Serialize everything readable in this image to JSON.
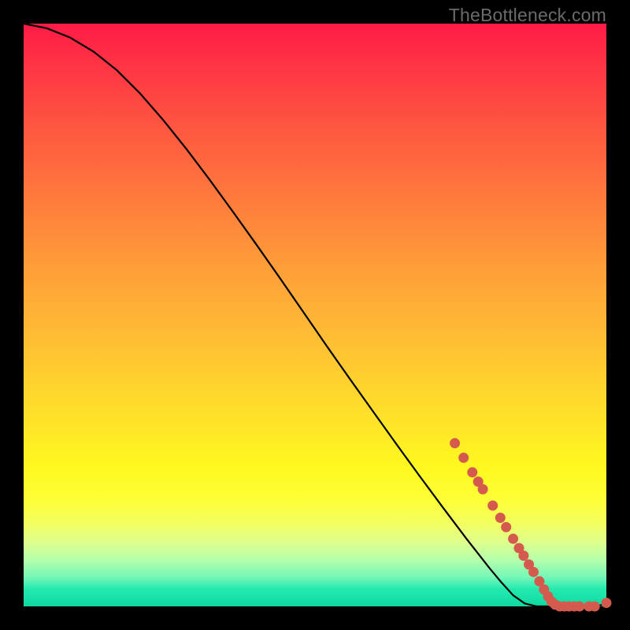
{
  "watermark": "TheBottleneck.com",
  "colors": {
    "curve": "#000000",
    "marker_fill": "#d35a4d",
    "marker_stroke": "#a8433a"
  },
  "chart_data": {
    "type": "line",
    "title": "",
    "xlabel": "",
    "ylabel": "",
    "xlim": [
      0,
      100
    ],
    "ylim": [
      0,
      100
    ],
    "grid": false,
    "series": [
      {
        "name": "curve",
        "x": [
          0,
          4,
          8,
          12,
          16,
          20,
          24,
          28,
          32,
          36,
          40,
          44,
          48,
          52,
          56,
          60,
          64,
          68,
          72,
          76,
          80,
          82,
          84,
          86,
          88,
          90,
          92,
          94,
          96,
          98,
          100
        ],
        "y": [
          100,
          99.2,
          97.6,
          95.2,
          92.0,
          88.0,
          83.4,
          78.4,
          73.1,
          67.6,
          62.0,
          56.3,
          50.5,
          44.7,
          39.0,
          33.4,
          27.8,
          22.3,
          16.9,
          11.6,
          6.5,
          4.1,
          1.9,
          0.5,
          0.0,
          0.0,
          0.0,
          0.0,
          0.0,
          0.0,
          0.4
        ]
      }
    ],
    "markers": [
      {
        "x": 74.0,
        "y": 28.0
      },
      {
        "x": 75.5,
        "y": 25.5
      },
      {
        "x": 77.0,
        "y": 23.0
      },
      {
        "x": 78.0,
        "y": 21.4
      },
      {
        "x": 78.8,
        "y": 20.1
      },
      {
        "x": 80.5,
        "y": 17.3
      },
      {
        "x": 81.8,
        "y": 15.2
      },
      {
        "x": 82.8,
        "y": 13.6
      },
      {
        "x": 84.0,
        "y": 11.6
      },
      {
        "x": 85.0,
        "y": 10.0
      },
      {
        "x": 85.8,
        "y": 8.7
      },
      {
        "x": 86.7,
        "y": 7.2
      },
      {
        "x": 87.5,
        "y": 5.9
      },
      {
        "x": 88.5,
        "y": 4.3
      },
      {
        "x": 89.3,
        "y": 2.9
      },
      {
        "x": 90.0,
        "y": 1.7
      },
      {
        "x": 90.6,
        "y": 0.8
      },
      {
        "x": 91.2,
        "y": 0.3
      },
      {
        "x": 92.0,
        "y": 0.0
      },
      {
        "x": 92.8,
        "y": 0.0
      },
      {
        "x": 93.6,
        "y": 0.0
      },
      {
        "x": 94.5,
        "y": 0.0
      },
      {
        "x": 95.4,
        "y": 0.0
      },
      {
        "x": 97.0,
        "y": 0.0
      },
      {
        "x": 98.0,
        "y": 0.0
      },
      {
        "x": 100.0,
        "y": 0.6
      }
    ]
  }
}
